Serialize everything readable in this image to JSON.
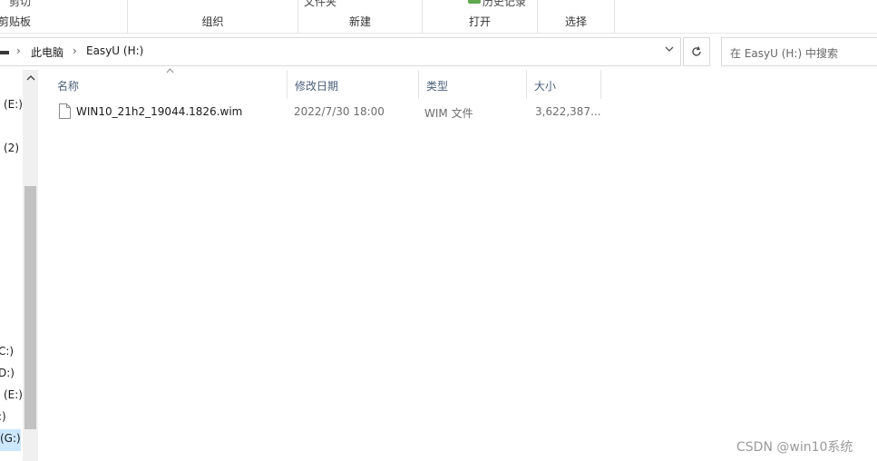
{
  "ribbon": {
    "clipboard_cut_label": "剪切",
    "groups": {
      "clipboard": "剪贴板",
      "organize": "组织",
      "new": "新建",
      "open": "打开",
      "select": "选择"
    },
    "partial_new_folder": "文件夹",
    "partial_properties": "历史记录"
  },
  "address_bar": {
    "crumbs": [
      "此电脑",
      "EasyU (H:)"
    ],
    "dropdown_icon": "chevron-down-icon",
    "refresh_icon": "refresh-icon"
  },
  "search": {
    "placeholder": "在 EasyU (H:) 中搜索"
  },
  "nav_pane": {
    "items": [
      "(E:)",
      "(2)",
      "C:)",
      "D:)",
      "(E:)",
      ":)",
      "(G:)"
    ]
  },
  "columns": {
    "name": "名称",
    "date": "修改日期",
    "type": "类型",
    "size": "大小"
  },
  "files": [
    {
      "name": "WIN10_21h2_19044.1826.wim",
      "date": "2022/7/30 18:00",
      "type": "WIM 文件",
      "size": "3,622,387..."
    }
  ],
  "watermark": "CSDN @win10系统",
  "colors": {
    "header_text": "#4c607a",
    "selection": "#cce8ff",
    "scroll_thumb": "#c2c2c2"
  }
}
